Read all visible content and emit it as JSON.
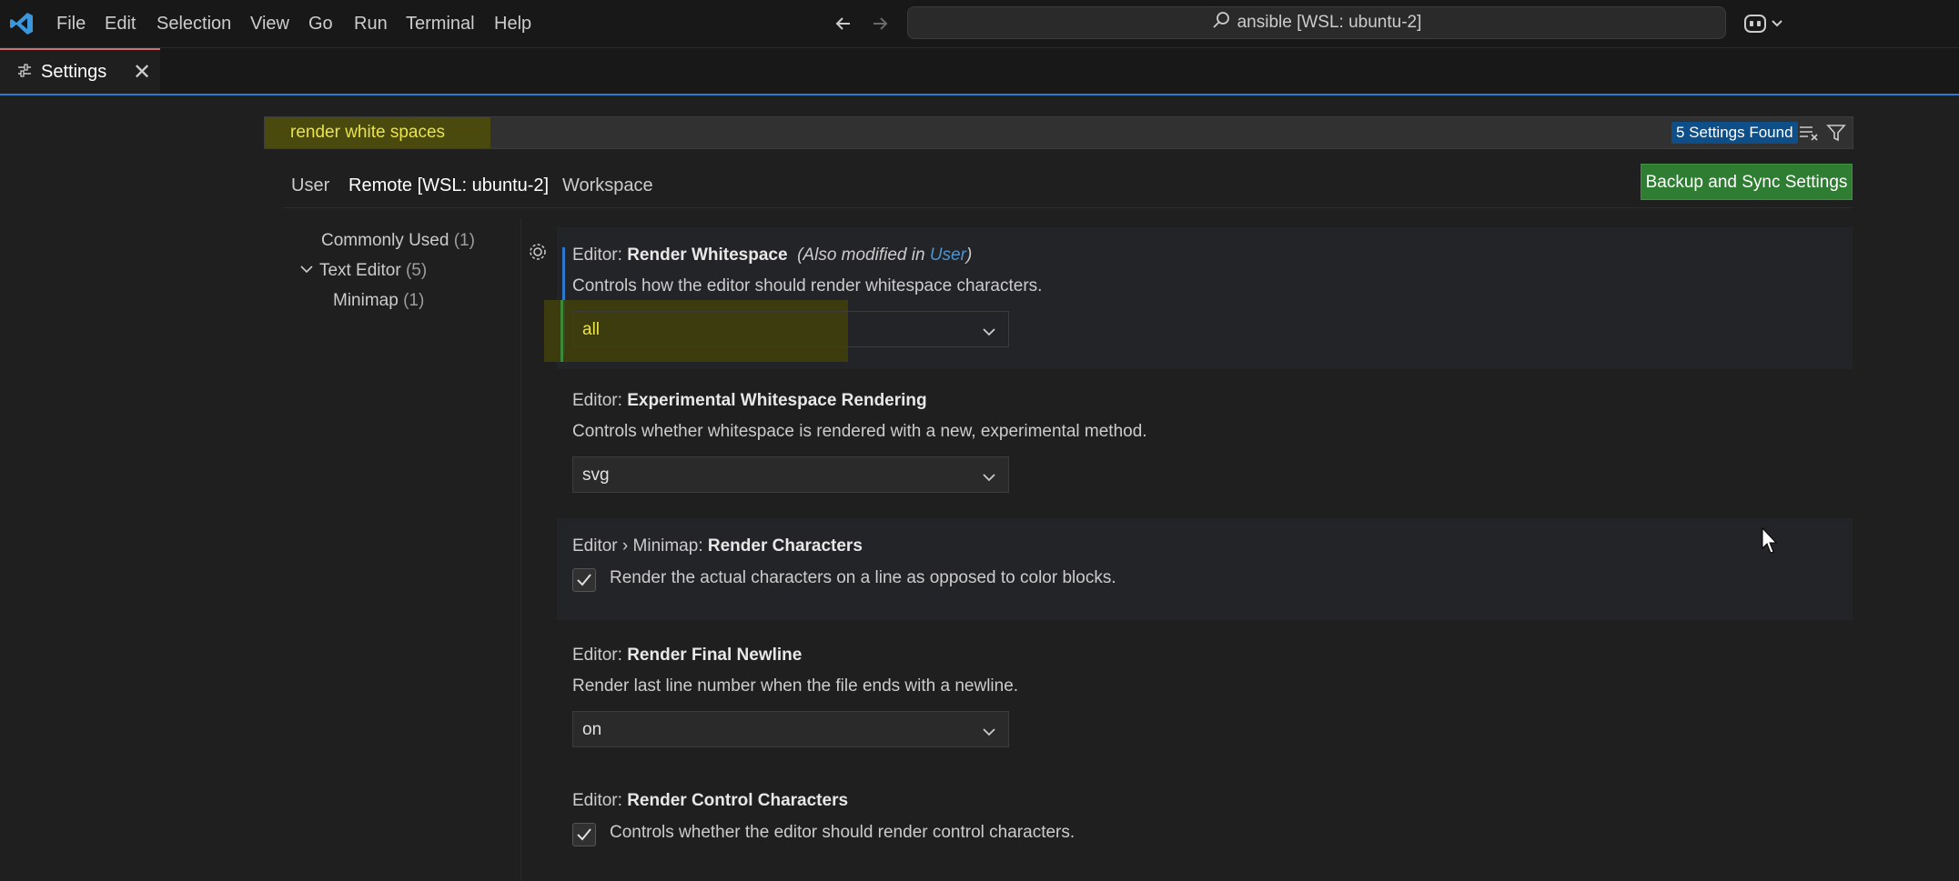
{
  "titlebar": {
    "menu": [
      "File",
      "Edit",
      "Selection",
      "View",
      "Go",
      "Run",
      "Terminal",
      "Help"
    ],
    "command_center": "ansible [WSL: ubuntu-2]"
  },
  "tab": {
    "label": "Settings"
  },
  "search": {
    "query": "render white spaces",
    "results": "5 Settings Found"
  },
  "scopes": {
    "user": "User",
    "remote": "Remote [WSL: ubuntu-2]",
    "workspace": "Workspace",
    "sync_button": "Backup and Sync Settings"
  },
  "toc": {
    "commonly_used": "Commonly Used",
    "commonly_used_count": "(1)",
    "text_editor": "Text Editor",
    "text_editor_count": "(5)",
    "minimap": "Minimap",
    "minimap_count": "(1)"
  },
  "settings": [
    {
      "category": "Editor: ",
      "name": "Render Whitespace",
      "note_prefix": "(Also modified in ",
      "note_link": "User",
      "note_suffix": ")",
      "description": "Controls how the editor should render whitespace characters.",
      "value": "all"
    },
    {
      "category": "Editor: ",
      "name": "Experimental Whitespace Rendering",
      "description": "Controls whether whitespace is rendered with a new, experimental method.",
      "value": "svg"
    },
    {
      "category": "Editor › Minimap: ",
      "name": "Render Characters",
      "description": "Render the actual characters on a line as opposed to color blocks.",
      "checked": true
    },
    {
      "category": "Editor: ",
      "name": "Render Final Newline",
      "description": "Render last line number when the file ends with a newline.",
      "value": "on"
    },
    {
      "category": "Editor: ",
      "name": "Render Control Characters",
      "description": "Controls whether the editor should render control characters.",
      "checked": true
    }
  ],
  "colors": {
    "accent": "#2b79d0",
    "search_match": "#e8e34a",
    "sync_button": "#2e7d32"
  }
}
